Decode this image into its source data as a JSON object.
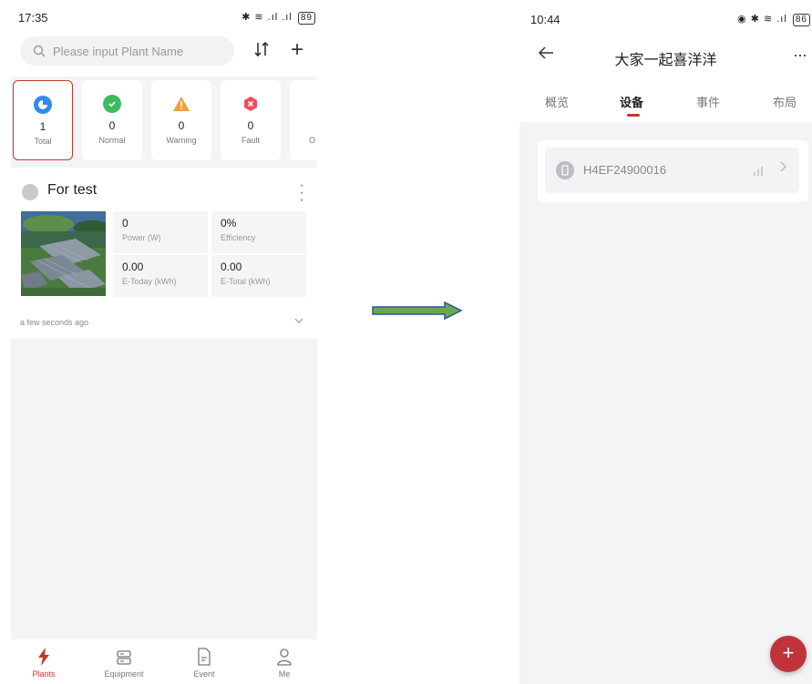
{
  "left": {
    "status_bar": {
      "time": "17:35",
      "battery": "89"
    },
    "search": {
      "placeholder": "Please input Plant Name"
    },
    "stats": [
      {
        "count": "1",
        "label": "Total",
        "color": "#2e8bea",
        "icon": "pie-chart-icon"
      },
      {
        "count": "0",
        "label": "Normal",
        "color": "#3dbb61",
        "icon": "check-circle-icon"
      },
      {
        "count": "0",
        "label": "Warning",
        "color": "#f2a03d",
        "icon": "warning-icon"
      },
      {
        "count": "0",
        "label": "Fault",
        "color": "#ee4d5a",
        "icon": "fault-hexagon-icon"
      },
      {
        "label": "O"
      }
    ],
    "plant": {
      "name": "For test",
      "metrics": [
        {
          "value": "0",
          "label": "Power (W)"
        },
        {
          "value": "0%",
          "label": "Efficiency"
        },
        {
          "value": "0.00",
          "label": "E-Today (kWh)"
        },
        {
          "value": "0.00",
          "label": "E-Total (kWh)"
        }
      ],
      "updated": "a few seconds ago"
    },
    "tabbar": [
      {
        "label": "Plants",
        "icon": "lightning-icon",
        "active": true
      },
      {
        "label": "Equipment",
        "icon": "server-icon"
      },
      {
        "label": "Event",
        "icon": "document-icon"
      },
      {
        "label": "Me",
        "icon": "person-icon"
      }
    ]
  },
  "right": {
    "status_bar": {
      "time": "10:44",
      "battery": "86"
    },
    "title": "大家一起喜洋洋",
    "tabs": [
      {
        "label": "概览"
      },
      {
        "label": "设备",
        "active": true
      },
      {
        "label": "事件"
      },
      {
        "label": "布局"
      }
    ],
    "device": {
      "serial": "H4EF24900016"
    }
  },
  "colors": {
    "accent": "#c0392b",
    "arrow": "#6aa84f",
    "arrow_outline": "#2f5597"
  }
}
